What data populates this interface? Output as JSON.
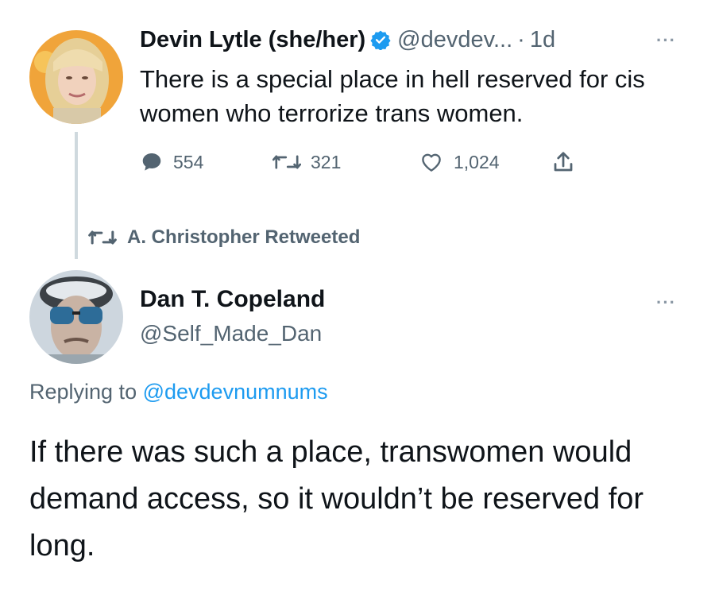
{
  "tweet1": {
    "name": "Devin Lytle (she/her)",
    "handle": "@devdev...",
    "separator": "·",
    "time": "1d",
    "more": "···",
    "text": "There is a special place in hell reserved for cis women who terrorize trans women.",
    "reply_count": "554",
    "retweet_count": "321",
    "like_count": "1,024",
    "verified_color": "#1d9bf0"
  },
  "retweet_banner": {
    "label": "A. Christopher Retweeted"
  },
  "tweet2": {
    "name": "Dan T. Copeland",
    "handle": "@Self_Made_Dan",
    "more": "···",
    "replying_prefix": "Replying to ",
    "replying_to": "@devdevnumnums",
    "text": "If there was such a place, transwomen would demand access, so it wouldn’t be reserved for long."
  },
  "colors": {
    "text_primary": "#0f1419",
    "text_secondary": "#536471",
    "accent": "#1d9bf0",
    "thread_line": "#cfd9de"
  },
  "icons": {
    "reply": "speech-bubble-icon",
    "retweet": "retweet-arrows-icon",
    "like": "heart-icon",
    "share": "share-upload-icon",
    "verified": "verified-badge-icon",
    "more": "more-dots-icon"
  }
}
